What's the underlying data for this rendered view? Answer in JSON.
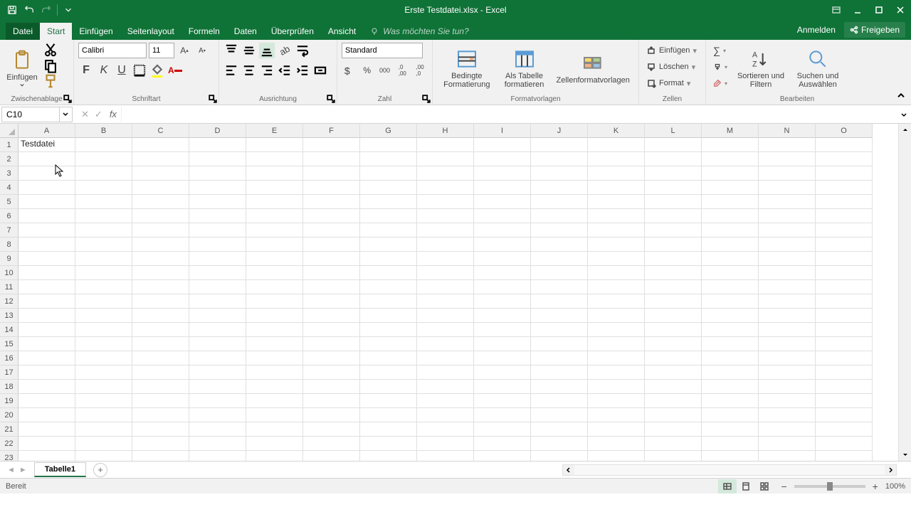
{
  "window": {
    "title": "Erste Testdatei.xlsx - Excel"
  },
  "tabs": {
    "file": "Datei",
    "home": "Start",
    "insert": "Einfügen",
    "pagelayout": "Seitenlayout",
    "formulas": "Formeln",
    "data": "Daten",
    "review": "Überprüfen",
    "view": "Ansicht",
    "tellme_placeholder": "Was möchten Sie tun?",
    "signin": "Anmelden",
    "share": "Freigeben"
  },
  "ribbon": {
    "clipboard": {
      "label": "Zwischenablage",
      "paste": "Einfügen"
    },
    "font": {
      "label": "Schriftart",
      "name": "Calibri",
      "size": "11"
    },
    "alignment": {
      "label": "Ausrichtung"
    },
    "number": {
      "label": "Zahl",
      "format": "Standard"
    },
    "styles": {
      "label": "Formatvorlagen",
      "conditional": "Bedingte Formatierung",
      "astable": "Als Tabelle formatieren",
      "cellstyles": "Zellenformatvorlagen"
    },
    "cells": {
      "label": "Zellen",
      "insert": "Einfügen",
      "delete": "Löschen",
      "format": "Format"
    },
    "editing": {
      "label": "Bearbeiten",
      "sort": "Sortieren und Filtern",
      "find": "Suchen und Auswählen"
    }
  },
  "namebox": "C10",
  "columns": [
    "A",
    "B",
    "C",
    "D",
    "E",
    "F",
    "G",
    "H",
    "I",
    "J",
    "K",
    "L",
    "M",
    "N",
    "O"
  ],
  "rows": [
    "1",
    "2",
    "3",
    "4",
    "5",
    "6",
    "7",
    "8",
    "9",
    "10",
    "11",
    "12",
    "13",
    "14",
    "15",
    "16",
    "17",
    "18",
    "19",
    "20",
    "21",
    "22",
    "23"
  ],
  "cells": {
    "A1": "Testdatei"
  },
  "sheet": {
    "tab1": "Tabelle1"
  },
  "status": {
    "ready": "Bereit",
    "zoom": "100%"
  }
}
